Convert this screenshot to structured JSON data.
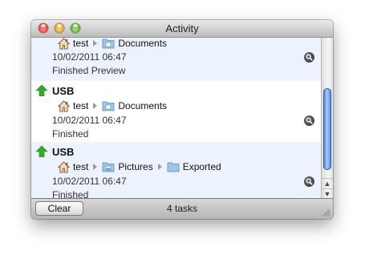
{
  "window": {
    "title": "Activity"
  },
  "tasks": [
    {
      "device": "",
      "path": [
        {
          "label": "test",
          "icon": "home-icon"
        },
        {
          "label": "Documents",
          "icon": "documents-folder-icon"
        }
      ],
      "timestamp": "10/02/2011 06:47",
      "status": "Finished Preview"
    },
    {
      "device": "USB",
      "path": [
        {
          "label": "test",
          "icon": "home-icon"
        },
        {
          "label": "Documents",
          "icon": "documents-folder-icon"
        }
      ],
      "timestamp": "10/02/2011 06:47",
      "status": "Finished"
    },
    {
      "device": "USB",
      "path": [
        {
          "label": "test",
          "icon": "home-icon"
        },
        {
          "label": "Pictures",
          "icon": "pictures-folder-icon"
        },
        {
          "label": "Exported",
          "icon": "folder-icon"
        }
      ],
      "timestamp": "10/02/2011 06:47",
      "status": "Finished"
    }
  ],
  "footer": {
    "clear_label": "Clear",
    "task_count": "4 tasks"
  },
  "colors": {
    "row_alt": "#edf3fe",
    "scroll_thumb": "#4c86e0",
    "upload_arrow": "#2fae2a"
  }
}
